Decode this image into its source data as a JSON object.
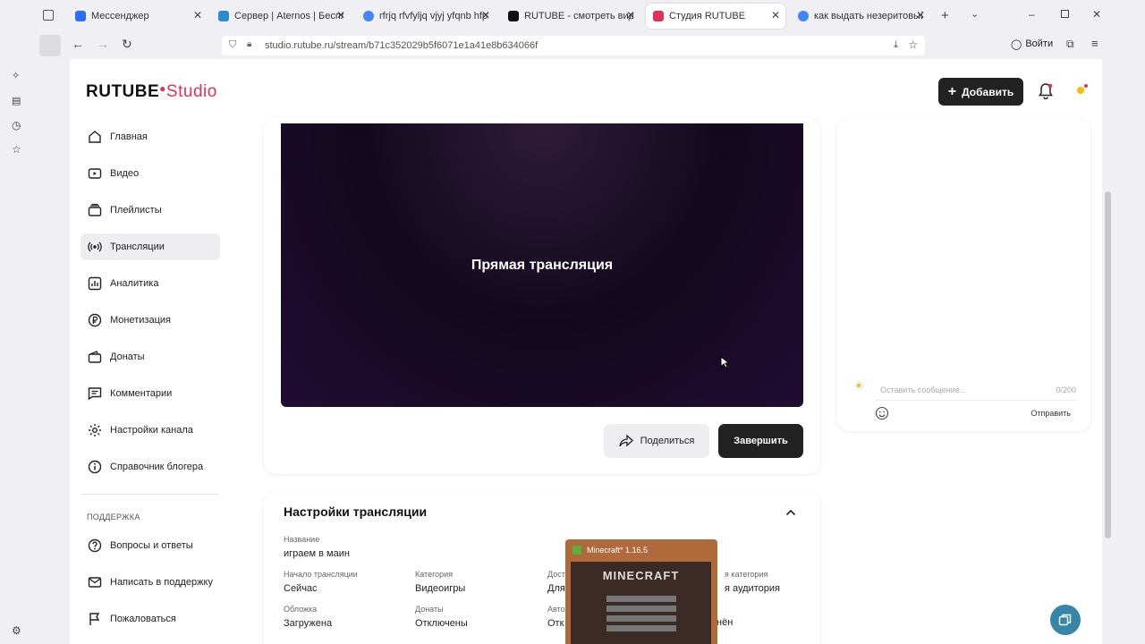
{
  "browser": {
    "tabs": [
      {
        "label": "Мессенджер",
        "color": "#2c6cf6"
      },
      {
        "label": "Сервер | Aternos | Бесплат",
        "color": "#2e8bcf"
      },
      {
        "label": "rfrjq rfvfyljq vjyj yfqnb hfph",
        "color": "#4285f4"
      },
      {
        "label": "RUTUBE - смотреть видео с",
        "color": "#111111"
      },
      {
        "label": "Студия RUTUBE",
        "color": "#e03256"
      },
      {
        "label": "как выдать незеритовый м",
        "color": "#4285f4"
      }
    ],
    "url": "studio.rutube.ru/stream/b71c352029b5f6071e1a41e8b634066f",
    "login_label": "Войти"
  },
  "header": {
    "logo_main": "RUTUBE",
    "logo_studio": "Studio",
    "add_label": "Добавить"
  },
  "sidebar": {
    "items": [
      {
        "label": "Главная",
        "icon": "home-icon"
      },
      {
        "label": "Видео",
        "icon": "video-icon"
      },
      {
        "label": "Плейлисты",
        "icon": "playlist-icon"
      },
      {
        "label": "Трансляции",
        "icon": "broadcast-icon"
      },
      {
        "label": "Аналитика",
        "icon": "analytics-icon"
      },
      {
        "label": "Монетизация",
        "icon": "monetization-icon"
      },
      {
        "label": "Донаты",
        "icon": "donate-icon"
      },
      {
        "label": "Комментарии",
        "icon": "comments-icon"
      },
      {
        "label": "Настройки канала",
        "icon": "settings-icon"
      },
      {
        "label": "Справочник блогера",
        "icon": "info-icon"
      }
    ],
    "support_title": "ПОДДЕРЖКА",
    "support_items": [
      {
        "label": "Вопросы и ответы",
        "icon": "question-icon"
      },
      {
        "label": "Написать в поддержку",
        "icon": "mail-icon"
      },
      {
        "label": "Пожаловаться",
        "icon": "flag-icon"
      }
    ]
  },
  "player": {
    "title": "Прямая трансляция",
    "share_label": "Поделиться",
    "end_label": "Завершить"
  },
  "chat": {
    "placeholder": "Оставить сообщение...",
    "counter": "0/200",
    "send_label": "Отправить"
  },
  "settings": {
    "title": "Настройки трансляции",
    "name_key": "Название",
    "name_value": "играем в маин",
    "start_key": "Начало трансляции",
    "start_value": "Сейчас",
    "category_key": "Категория",
    "category_value": "Видеоигры",
    "access_key": "Дост",
    "access_value": "Для",
    "agecat_key": "я категория",
    "agecat_value": "я аудитория",
    "cover_key": "Обложка",
    "cover_value": "Загружена",
    "donates_key": "Донаты",
    "donates_value": "Отключены",
    "auto_key": "Авто",
    "auto_value": "Отк",
    "extra_value": "нён"
  },
  "minecraft": {
    "title": "Minecraft* 1.16.5",
    "logo": "MINECRAFT"
  }
}
